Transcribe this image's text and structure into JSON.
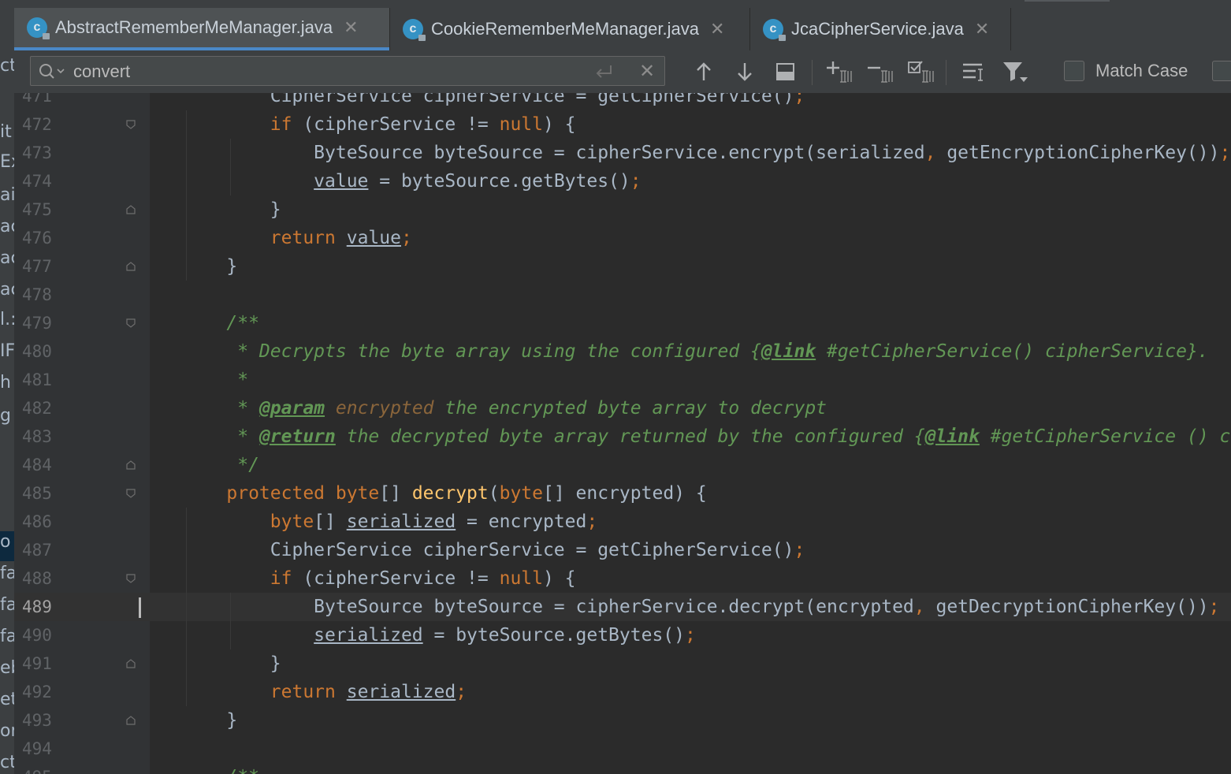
{
  "tabs": [
    {
      "title": "AbstractRememberMeManager.java",
      "icon": "class-icon",
      "active": true
    },
    {
      "title": "CookieRememberMeManager.java",
      "icon": "class-icon",
      "active": false
    },
    {
      "title": "JcaCipherService.java",
      "icon": "class-icon",
      "active": false
    }
  ],
  "find": {
    "query": "convert",
    "match_case_label": "Match Case",
    "tools": [
      "previous-occurrence-icon",
      "next-occurrence-icon",
      "find-all-icon",
      "add-selection-icon",
      "remove-selection-icon",
      "select-all-occurrences-icon",
      "multiline-icon",
      "filter-icon"
    ]
  },
  "left_fragments": [
    "ct",
    "it",
    "Ex",
    "ail",
    "ac",
    "ac",
    "ac",
    "l.:",
    "IF",
    "h",
    "g",
    "o",
    "fa",
    "fa",
    "fa",
    "eb",
    "et",
    "or",
    "ct"
  ],
  "colors": {
    "keyword": "#cc7832",
    "function": "#ffc66d",
    "comment": "#629755",
    "text": "#a9b7c6",
    "accent": "#4a88c7"
  },
  "editor": {
    "current_line": "489",
    "lines": [
      {
        "n": "471",
        "t": [
          [
            "        CipherService cipherService = getCipherService()",
            ""
          ],
          [
            ";",
            "kw"
          ]
        ]
      },
      {
        "n": "472",
        "t": [
          [
            "        ",
            ""
          ],
          [
            "if",
            "kw"
          ],
          [
            " (cipherService != ",
            ""
          ],
          [
            "null",
            "kw"
          ],
          [
            ") {",
            ""
          ]
        ]
      },
      {
        "n": "473",
        "t": [
          [
            "            ByteSource byteSource = cipherService.encrypt(serialized",
            ""
          ],
          [
            ",",
            "kw"
          ],
          [
            " getEncryptionCipherKey())",
            ""
          ],
          [
            ";",
            "kw"
          ]
        ]
      },
      {
        "n": "474",
        "t": [
          [
            "            ",
            ""
          ],
          [
            "value",
            "ul"
          ],
          [
            " = byteSource.getBytes()",
            ""
          ],
          [
            ";",
            "kw"
          ]
        ]
      },
      {
        "n": "475",
        "t": [
          [
            "        }",
            ""
          ]
        ]
      },
      {
        "n": "476",
        "t": [
          [
            "        ",
            ""
          ],
          [
            "return",
            "kw"
          ],
          [
            " ",
            ""
          ],
          [
            "value",
            "ul"
          ],
          [
            ";",
            "kw"
          ]
        ]
      },
      {
        "n": "477",
        "t": [
          [
            "    }",
            ""
          ]
        ]
      },
      {
        "n": "478",
        "t": []
      },
      {
        "n": "479",
        "t": [
          [
            "    /**",
            "cm"
          ]
        ]
      },
      {
        "n": "480",
        "t": [
          [
            "     * Decrypts the byte array using the configured {",
            "cm"
          ],
          [
            "@link",
            "tag"
          ],
          [
            " #getCipherService() cipherService}.",
            "cm"
          ]
        ]
      },
      {
        "n": "481",
        "t": [
          [
            "     *",
            "cm"
          ]
        ]
      },
      {
        "n": "482",
        "t": [
          [
            "     * ",
            "cm"
          ],
          [
            "@param",
            "tag"
          ],
          [
            " ",
            "cm"
          ],
          [
            "encrypted",
            "prm"
          ],
          [
            " the encrypted byte array to decrypt",
            "cm"
          ]
        ]
      },
      {
        "n": "483",
        "t": [
          [
            "     * ",
            "cm"
          ],
          [
            "@return",
            "tag"
          ],
          [
            " the decrypted byte array returned by the configured {",
            "cm"
          ],
          [
            "@link",
            "tag"
          ],
          [
            " #getCipherService () ciph",
            "cm"
          ]
        ]
      },
      {
        "n": "484",
        "t": [
          [
            "     */",
            "cm"
          ]
        ]
      },
      {
        "n": "485",
        "t": [
          [
            "    ",
            ""
          ],
          [
            "protected byte",
            "kw"
          ],
          [
            "[] ",
            ""
          ],
          [
            "decrypt",
            "fn"
          ],
          [
            "(",
            ""
          ],
          [
            "byte",
            "kw"
          ],
          [
            "[] encrypted) {",
            ""
          ]
        ]
      },
      {
        "n": "486",
        "t": [
          [
            "        ",
            ""
          ],
          [
            "byte",
            "kw"
          ],
          [
            "[] ",
            ""
          ],
          [
            "serialized",
            "ul"
          ],
          [
            " = encrypted",
            ""
          ],
          [
            ";",
            "kw"
          ]
        ]
      },
      {
        "n": "487",
        "t": [
          [
            "        CipherService cipherService = getCipherService()",
            ""
          ],
          [
            ";",
            "kw"
          ]
        ]
      },
      {
        "n": "488",
        "t": [
          [
            "        ",
            ""
          ],
          [
            "if",
            "kw"
          ],
          [
            " (cipherService != ",
            ""
          ],
          [
            "null",
            "kw"
          ],
          [
            ") {",
            ""
          ]
        ]
      },
      {
        "n": "489",
        "t": [
          [
            "            ByteSource byteSource = cipherService.decrypt(encrypted",
            ""
          ],
          [
            ",",
            "kw"
          ],
          [
            " getDecryptionCipherKey())",
            ""
          ],
          [
            ";",
            "kw"
          ]
        ]
      },
      {
        "n": "490",
        "t": [
          [
            "            ",
            ""
          ],
          [
            "serialized",
            "ul"
          ],
          [
            " = byteSource.getBytes()",
            ""
          ],
          [
            ";",
            "kw"
          ]
        ]
      },
      {
        "n": "491",
        "t": [
          [
            "        }",
            ""
          ]
        ]
      },
      {
        "n": "492",
        "t": [
          [
            "        ",
            ""
          ],
          [
            "return",
            "kw"
          ],
          [
            " ",
            ""
          ],
          [
            "serialized",
            "ul"
          ],
          [
            ";",
            "kw"
          ]
        ]
      },
      {
        "n": "493",
        "t": [
          [
            "    }",
            ""
          ]
        ]
      },
      {
        "n": "494",
        "t": []
      },
      {
        "n": "495",
        "t": [
          [
            "    /**",
            "cm"
          ]
        ]
      }
    ]
  }
}
